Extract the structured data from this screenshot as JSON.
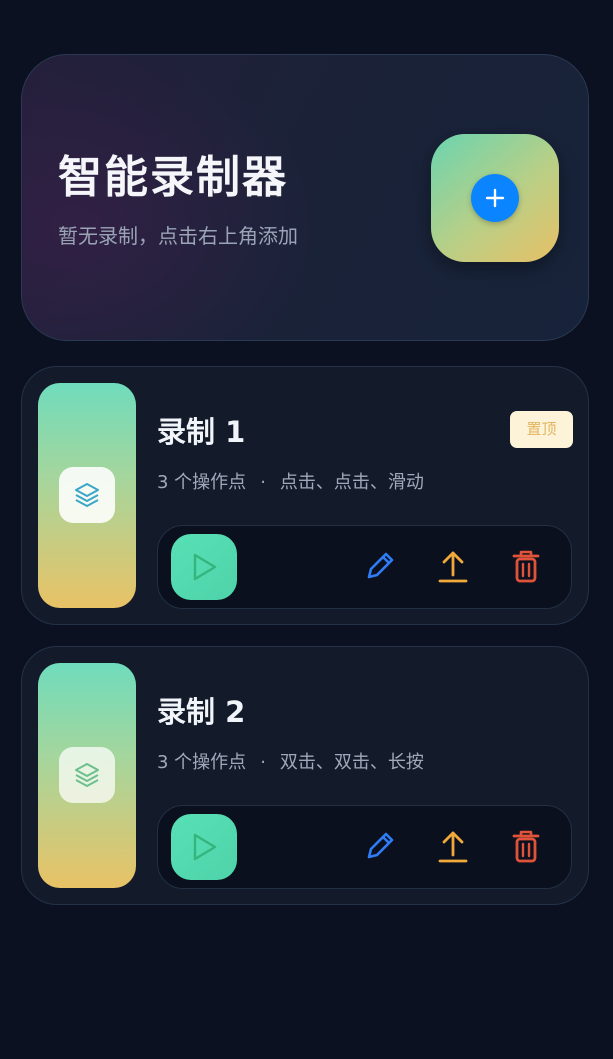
{
  "header": {
    "title": "智能录制器",
    "subtitle": "暂无录制，点击右上角添加",
    "add_icon": "plus-icon"
  },
  "colors": {
    "background": "#0b1120",
    "card": "#131b2b",
    "accent_blue": "#0a84ff",
    "play_green": "#58e0b5",
    "edit_blue": "#2f7cf6",
    "upload_orange": "#f2a93b",
    "delete_red": "#e0533b",
    "pin_badge_bg": "#fdf3d8",
    "pin_badge_text": "#e3b660"
  },
  "recordings": [
    {
      "title": "录制 1",
      "count": "3 个操作点",
      "separator": "·",
      "actions": "点击、点击、滑动",
      "pin_label": "置顶",
      "thumb_icon": "layers-icon"
    },
    {
      "title": "录制 2",
      "count": "3 个操作点",
      "separator": "·",
      "actions": "双击、双击、长按",
      "thumb_icon": "layers-icon"
    }
  ],
  "icons": {
    "play": "play-icon",
    "edit": "pencil-icon",
    "upload": "upload-icon",
    "delete": "trash-icon"
  }
}
